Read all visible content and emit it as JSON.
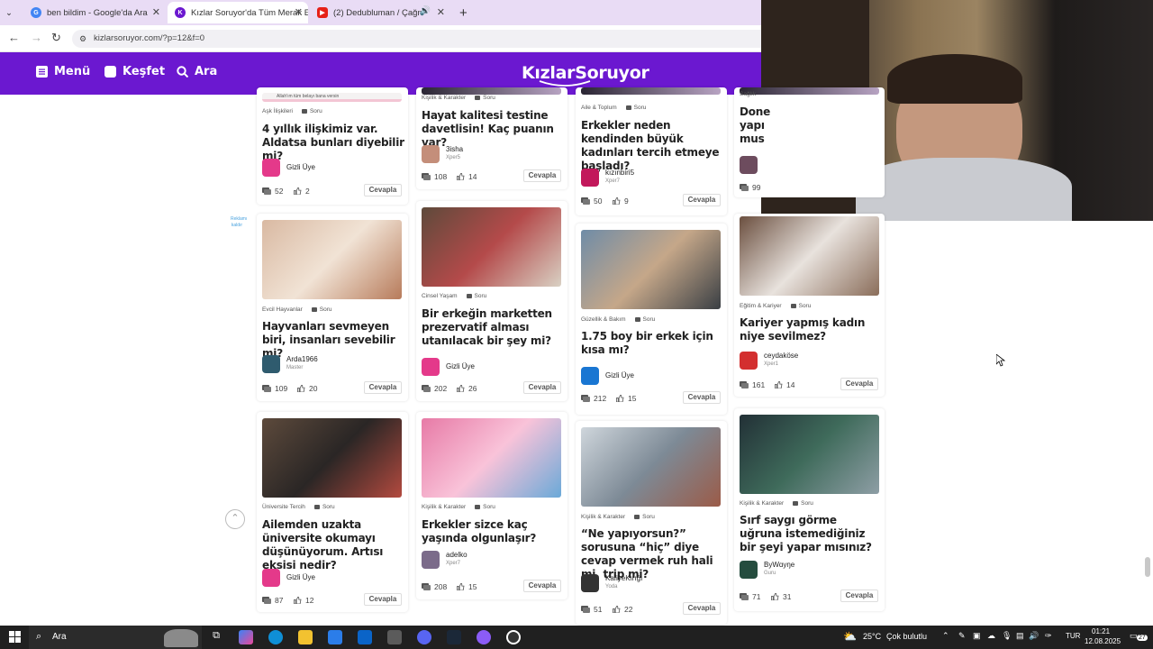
{
  "browser": {
    "tabs": [
      {
        "title": "ben bildim - Google'da Ara",
        "active": false
      },
      {
        "title": "Kızlar Soruyor'da Tüm Merak Ed",
        "active": true
      },
      {
        "title": "(2) Dedubluman / Çağn Çe",
        "active": false
      }
    ],
    "url": "kizlarsoruyor.com/?p=12&f=0"
  },
  "site": {
    "menu": "Menü",
    "explore": "Keşfet",
    "search": "Ara",
    "logo": "KızlarSoruyor",
    "brand_color": "#6b18d0"
  },
  "cards": [
    {
      "top_caption": "Allah'ım tüm belayı bana versin",
      "category": "Aşk İlişkileri",
      "type": "Soru",
      "title": "4 yıllık ilişkimiz var. Aldatsa bunları diyebilir mi?",
      "user": "Gizli Üye",
      "level": "",
      "comments": "52",
      "likes": "2",
      "button": "Cevapla"
    },
    {
      "category": "Kişilik & Karakter",
      "type": "Soru",
      "title": "Hayat kalitesi testine davetlisin! Kaç puanın var?",
      "user": "3isha",
      "level": "Xper5",
      "comments": "108",
      "likes": "14",
      "button": "Cevapla"
    },
    {
      "category": "Aile & Toplum",
      "type": "Soru",
      "title": "Erkekler neden kendinden büyük kadınları tercih etmeye başladı?",
      "user": "kızınbiri5",
      "level": "Xper7",
      "comments": "50",
      "likes": "9",
      "button": "Cevapla"
    },
    {
      "category": "Sağlık",
      "type": "",
      "title": "Done yapı mus",
      "user": "",
      "level": "",
      "comments": "99",
      "likes": "",
      "button": ""
    },
    {
      "category": "Evcil Hayvanlar",
      "type": "Soru",
      "title": "Hayvanları sevmeyen biri, insanları sevebilir mi?",
      "user": "Arda1966",
      "level": "Master",
      "comments": "109",
      "likes": "20",
      "button": "Cevapla"
    },
    {
      "category": "Cinsel Yaşam",
      "type": "Soru",
      "title": "Bir erkeğin marketten prezervatif alması utanılacak bir şey mi?",
      "user": "Gizli Üye",
      "level": "",
      "comments": "202",
      "likes": "26",
      "button": "Cevapla"
    },
    {
      "category": "Güzellik & Bakım",
      "type": "Soru",
      "title": "1.75 boy bir erkek için kısa mı?",
      "user": "Gizli Üye",
      "level": "",
      "comments": "212",
      "likes": "15",
      "button": "Cevapla"
    },
    {
      "category": "Eğitim & Kariyer",
      "type": "Soru",
      "title": "Kariyer yapmış kadın niye sevilmez?",
      "user": "ceydaköse",
      "level": "Xper1",
      "comments": "161",
      "likes": "14",
      "button": "Cevapla"
    },
    {
      "category": "Üniversite Tercih",
      "type": "Soru",
      "title": "Ailemden uzakta üniversite okumayı düşünüyorum. Artısı eksisi nedir?",
      "user": "Gizli Üye",
      "level": "",
      "comments": "87",
      "likes": "12",
      "button": "Cevapla"
    },
    {
      "category": "Kişilik & Karakter",
      "type": "Soru",
      "title": "Erkekler sizce kaç yaşında olgunlaşır?",
      "user": "adelko",
      "level": "Xper7",
      "comments": "208",
      "likes": "15",
      "button": "Cevapla"
    },
    {
      "category": "Kişilik & Karakter",
      "type": "Soru",
      "title": "“Ne yapıyorsun?” sorusuna “hiç” diye cevap vermek ruh hali mi, trip mi?",
      "user": "KafiyeKırığı",
      "level": "Yoda",
      "comments": "51",
      "likes": "22",
      "button": "Cevapla"
    },
    {
      "category": "Kişilik & Karakter",
      "type": "Soru",
      "title": "Sırf saygı görme uğruna istemediğiniz bir şeyi yapar mısınız?",
      "user": "ByWɑyŋe",
      "level": "Guru",
      "comments": "71",
      "likes": "31",
      "button": "Cevapla"
    }
  ],
  "side_ad": "Reklamı kaldır",
  "taskbar": {
    "search": "Ara",
    "weather_temp": "25°C",
    "weather_desc": "Çok bulutlu",
    "lang": "TUR",
    "time": "01:21",
    "date": "12.08.2025",
    "notif": "27"
  }
}
